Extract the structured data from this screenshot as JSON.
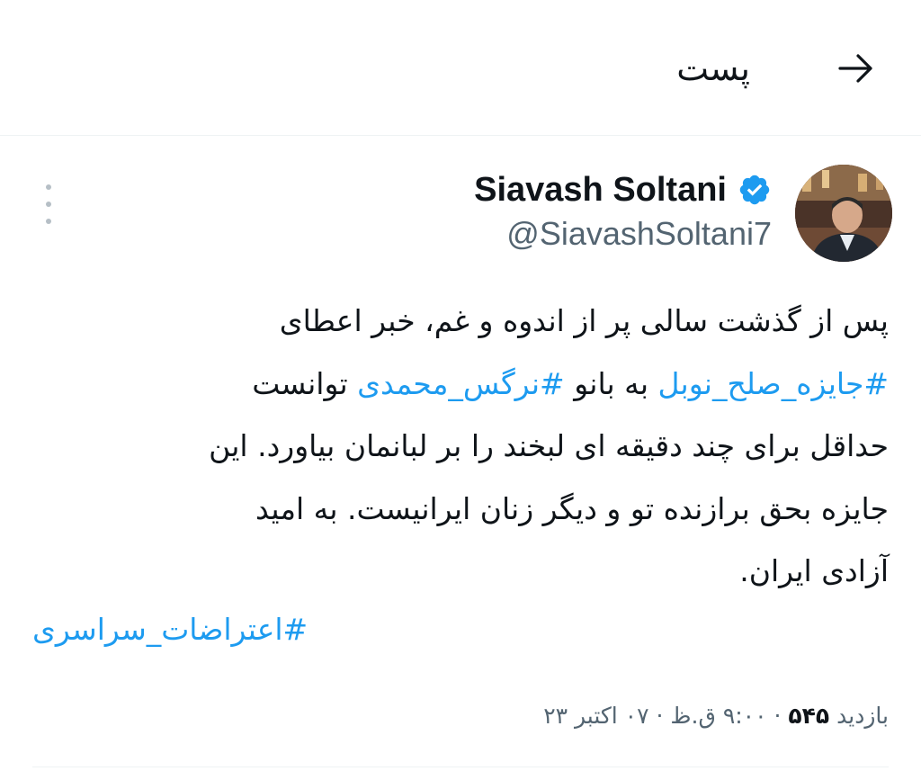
{
  "header": {
    "title": "پست",
    "back_icon": "arrow-right-icon"
  },
  "tweet": {
    "author": {
      "display_name": "Siavash Soltani",
      "handle": "@SiavashSoltani7",
      "verified": true,
      "verified_color": "#1d9bf0"
    },
    "body": {
      "line1": "پس از گذشت سالی پر از اندوه و غم، خبر اعطای",
      "line2_hashtag1": "#جایزه_صلح_نوبل",
      "line2_mid": " به بانو ",
      "line2_hashtag2": "#نرگس_محمدی",
      "line2_end": " توانست",
      "line3": "حداقل برای چند دقیقه ای لبخند را بر لبانمان بیاورد. این",
      "line4": "جایزه بحق برازنده تو و دیگر زنان ایرانیست. به امید",
      "line5": "آزادی ایران."
    },
    "trailing_hashtag": "#اعتراضات_سراسری",
    "meta": {
      "views_label": "بازدید",
      "views_count": "۵۴۵",
      "separator": "·",
      "time": "۹:۰۰ ق.ظ",
      "date": "۰۷ اکتبر ۲۳"
    }
  },
  "colors": {
    "link": "#1d9bf0",
    "text": "#0f1419",
    "secondary": "#536471",
    "divider": "#eff3f4"
  }
}
